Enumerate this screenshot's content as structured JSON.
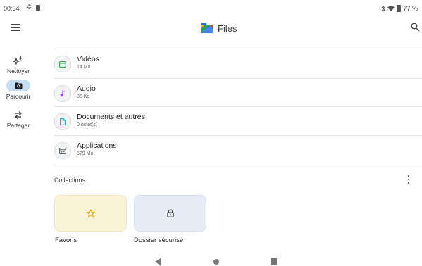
{
  "status_bar": {
    "time": "00:34",
    "battery": "77 %"
  },
  "app": {
    "title": "Files"
  },
  "nav_rail": [
    {
      "label": "Nettoyer",
      "icon": "sparkle-icon",
      "active": false
    },
    {
      "label": "Parcourir",
      "icon": "browse-icon",
      "active": true
    },
    {
      "label": "Partager",
      "icon": "share-arrows-icon",
      "active": false
    }
  ],
  "categories": [
    {
      "title": "Vidéos",
      "subtitle": "14 Mo",
      "icon": "video-icon",
      "color": "#34a853"
    },
    {
      "title": "Audio",
      "subtitle": "85 Ko",
      "icon": "music-note-icon",
      "color": "#a142f4"
    },
    {
      "title": "Documents et autres",
      "subtitle": "0 octet(s)",
      "icon": "document-icon",
      "color": "#12b5cb"
    },
    {
      "title": "Applications",
      "subtitle": "529 Mo",
      "icon": "apps-icon",
      "color": "#5f6368"
    }
  ],
  "collections": {
    "title": "Collections",
    "items": [
      {
        "label": "Favoris",
        "icon": "star-icon",
        "color": "#f9ab00"
      },
      {
        "label": "Dossier sécurisé",
        "icon": "lock-icon",
        "color": "#444746"
      }
    ]
  },
  "colors": {
    "accent": "#c5def5",
    "divider": "#e3e3e3"
  }
}
